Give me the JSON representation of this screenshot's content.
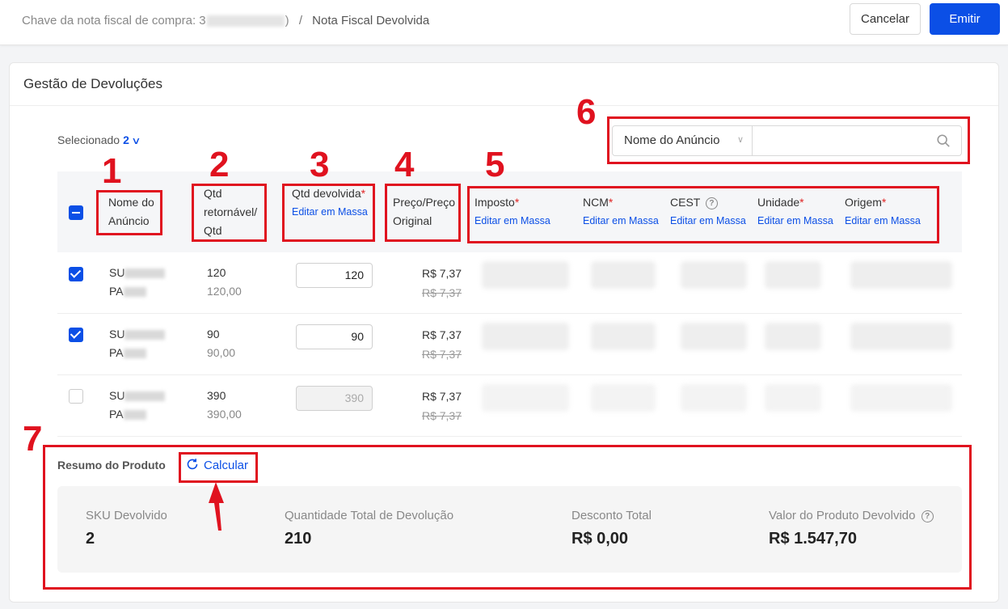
{
  "topbar": {
    "breadcrumb_prefix": "Chave da nota fiscal de compra: 3",
    "breadcrumb_suffix": ")",
    "breadcrumb_separator": "/",
    "breadcrumb_current": "Nota Fiscal Devolvida",
    "cancel_label": "Cancelar",
    "emit_label": "Emitir"
  },
  "panel": {
    "title": "Gestão de Devoluções"
  },
  "selection": {
    "label": "Selecionado",
    "count": "2"
  },
  "search": {
    "field_select": "Nome do Anúncio",
    "placeholder": ""
  },
  "columns": {
    "name": "Nome do Anúncio",
    "qty_returnable": "Qtd retornável/ Qtd",
    "qty_returned": "Qtd devolvida",
    "price": "Preço/Preço Original",
    "tax": "Imposto",
    "ncm": "NCM",
    "cest": "CEST",
    "unit": "Unidade",
    "origin": "Origem",
    "mass_edit": "Editar em Massa",
    "required_mark": "*",
    "help_mark": "?"
  },
  "rows": [
    {
      "name_line1": "SU",
      "name_line2": "PA",
      "qty": "120",
      "qty_sub": "120,00",
      "qty_returned": "120",
      "price": "R$ 7,37",
      "price_original": "R$ 7,37",
      "checked": true
    },
    {
      "name_line1": "SU",
      "name_line2": "PA",
      "qty": "90",
      "qty_sub": "90,00",
      "qty_returned": "90",
      "price": "R$ 7,37",
      "price_original": "R$ 7,37",
      "checked": true
    },
    {
      "name_line1": "SU",
      "name_line2": "PA",
      "qty": "390",
      "qty_sub": "390,00",
      "qty_returned": "390",
      "price": "R$ 7,37",
      "price_original": "R$ 7,37",
      "checked": false
    }
  ],
  "summary": {
    "title": "Resumo do Produto",
    "calculate_label": "Calcular",
    "kpis": [
      {
        "label": "SKU Devolvido",
        "value": "2"
      },
      {
        "label": "Quantidade Total de Devolução",
        "value": "210"
      },
      {
        "label": "Desconto Total",
        "value": "R$ 0,00"
      },
      {
        "label": "Valor do Produto Devolvido",
        "value": "R$ 1.547,70"
      }
    ]
  },
  "annotations": {
    "numbers": [
      "1",
      "2",
      "3",
      "4",
      "5",
      "6",
      "7"
    ],
    "color": "#e0121f"
  },
  "colors": {
    "accent": "#0b4fe6",
    "required": "#e02424"
  }
}
